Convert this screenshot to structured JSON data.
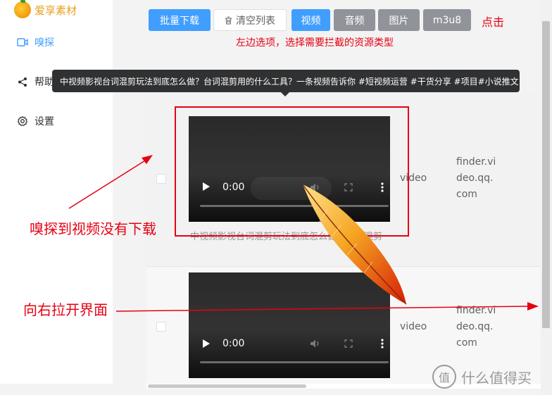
{
  "app": {
    "logo_text": "爱享素材"
  },
  "sidebar": {
    "items": [
      {
        "label": "嗅探",
        "icon": "video-camera-icon",
        "active": true
      },
      {
        "label": "帮助",
        "icon": "share-icon",
        "active": false
      },
      {
        "label": "设置",
        "icon": "gear-icon",
        "active": false
      }
    ]
  },
  "toolbar": {
    "batch_download": "批量下载",
    "clear_list": "清空列表",
    "filters": [
      "视频",
      "音频",
      "图片",
      "m3u8"
    ],
    "active_filter": "视频"
  },
  "notes": {
    "click": "点击",
    "filter_hint": "左边选项，选择需要拦截的资源类型"
  },
  "tooltip": {
    "text": "中视频影视台词混剪玩法到底怎么做？台词混剪用的什么工具？一条视频告诉你 #短视频运营 #干货分享 #项目#小说推文"
  },
  "table": {
    "rows": [
      {
        "title": "中视频影视台词混剪玩法到底怎么做？台词混剪",
        "time": "0:00",
        "type": "video",
        "source": [
          "finder.vi",
          "deo.qq.",
          "com"
        ]
      },
      {
        "title": "",
        "time": "0:00",
        "type": "video",
        "source": [
          "finder.vi",
          "deo.qq.",
          "com"
        ]
      }
    ]
  },
  "annotations": {
    "sniff_no_download": "嗅探到视频没有下载",
    "drag_right": "向右拉开界面"
  },
  "watermark": {
    "logo": "值",
    "text": "什么值得买"
  },
  "colors": {
    "primary": "#409eff",
    "annotation": "#e60012",
    "filter_gray": "#909399"
  }
}
